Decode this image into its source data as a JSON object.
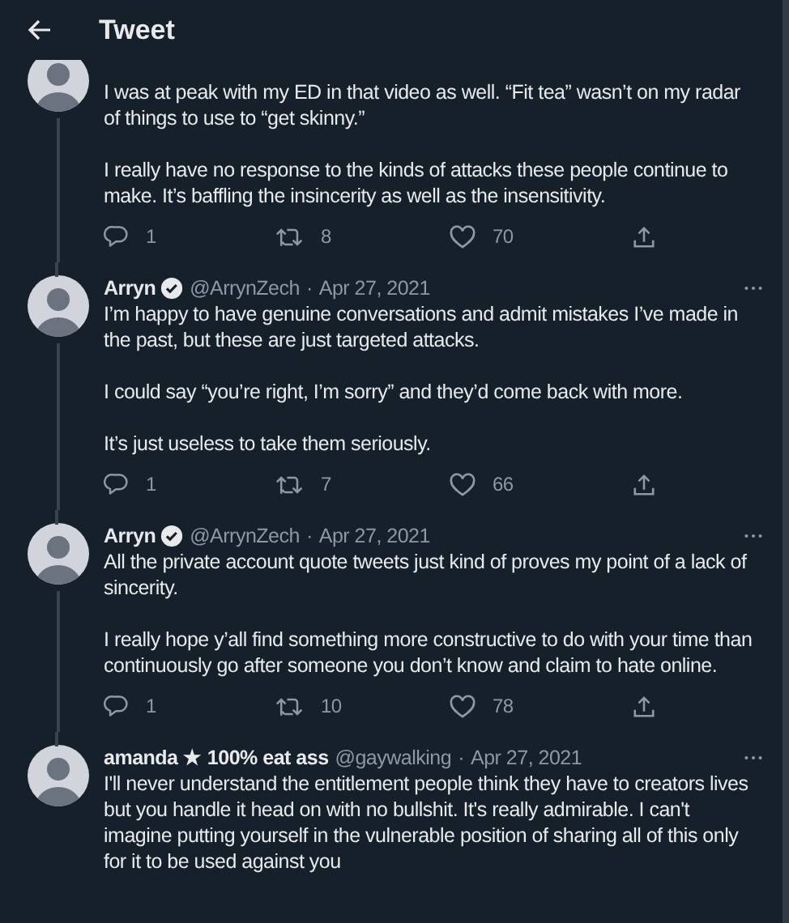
{
  "header": {
    "title": "Tweet"
  },
  "tweets": [
    {
      "paragraphs": [
        "I was at peak with my ED in that video as well. “Fit tea” wasn’t on my radar of things to use to “get skinny.”",
        "I really have no response to the kinds of attacks these people continue to make. It’s baffling the insincerity as well as the insensitivity."
      ],
      "replies": "1",
      "retweets": "8",
      "likes": "70",
      "connected_below": true
    },
    {
      "author": {
        "name": "Arryn",
        "verified": true,
        "handle": "@ArrynZech",
        "separator": "·",
        "date": "Apr 27, 2021"
      },
      "paragraphs": [
        "I’m happy to have genuine conversations and admit mistakes I’ve made in the past, but these are just targeted attacks.",
        "I could say “you’re right, I’m sorry” and they’d come back with more.",
        "It’s just useless to take them seriously."
      ],
      "replies": "1",
      "retweets": "7",
      "likes": "66",
      "connected_below": true
    },
    {
      "author": {
        "name": "Arryn",
        "verified": true,
        "handle": "@ArrynZech",
        "separator": "·",
        "date": "Apr 27, 2021"
      },
      "paragraphs": [
        "All the private account quote tweets just kind of proves my point of a lack of sincerity.",
        "I really hope y’all find something more constructive to do with your time than continuously go after someone you don’t know and claim to hate online."
      ],
      "replies": "1",
      "retweets": "10",
      "likes": "78",
      "connected_below": true
    },
    {
      "author": {
        "name": "amanda ★ 100% eat ass",
        "verified": false,
        "handle": "@gaywalking",
        "separator": "·",
        "date": "Apr 27, 2021"
      },
      "paragraphs": [
        "I'll never understand the entitlement people think they have to creators lives but you handle it head on with no bullshit. It's really admirable. I can't imagine putting yourself in the vulnerable position of sharing all of this only for it to be used against you"
      ],
      "connected_below": false
    }
  ]
}
